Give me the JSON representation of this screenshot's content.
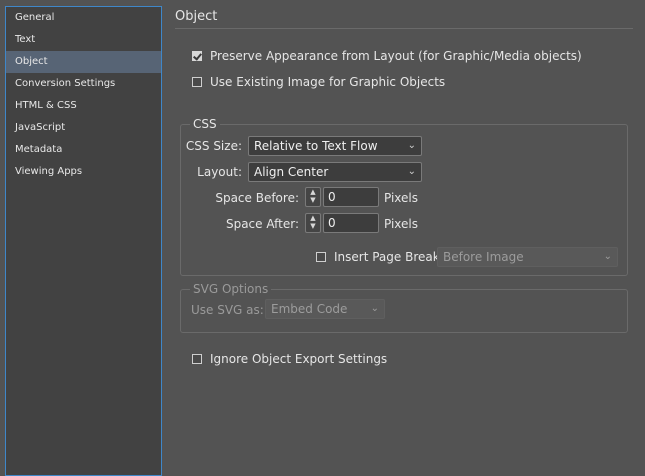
{
  "sidebar": {
    "items": [
      {
        "label": "General"
      },
      {
        "label": "Text"
      },
      {
        "label": "Object"
      },
      {
        "label": "Conversion Settings"
      },
      {
        "label": "HTML & CSS"
      },
      {
        "label": "JavaScript"
      },
      {
        "label": "Metadata"
      },
      {
        "label": "Viewing Apps"
      }
    ],
    "selected": "Object"
  },
  "section_title": "Object",
  "options": {
    "preserve_appearance": {
      "label": "Preserve Appearance from Layout (for Graphic/Media objects)",
      "checked": true
    },
    "use_existing_image": {
      "label": "Use Existing Image for Graphic Objects",
      "checked": false
    }
  },
  "css_group": {
    "title": "CSS",
    "css_size": {
      "label": "CSS Size:",
      "value": "Relative to Text Flow"
    },
    "layout": {
      "label": "Layout:",
      "value": "Align Center"
    },
    "space_before": {
      "label": "Space Before:",
      "value": "0",
      "unit": "Pixels"
    },
    "space_after": {
      "label": "Space After:",
      "value": "0",
      "unit": "Pixels"
    },
    "insert_page_break": {
      "label": "Insert Page Break",
      "checked": false,
      "value": "Before Image"
    }
  },
  "svg_group": {
    "title": "SVG Options",
    "use_svg_as": {
      "label": "Use SVG as:",
      "value": "Embed Code"
    }
  },
  "ignore_export": {
    "label": "Ignore Object Export Settings",
    "checked": false
  },
  "icons": {
    "dropdown": "chevron-down-icon",
    "stepper": "stepper-icon"
  },
  "colors": {
    "selection": "#576475",
    "focus_border": "#3f87c9",
    "background": "#535353"
  }
}
